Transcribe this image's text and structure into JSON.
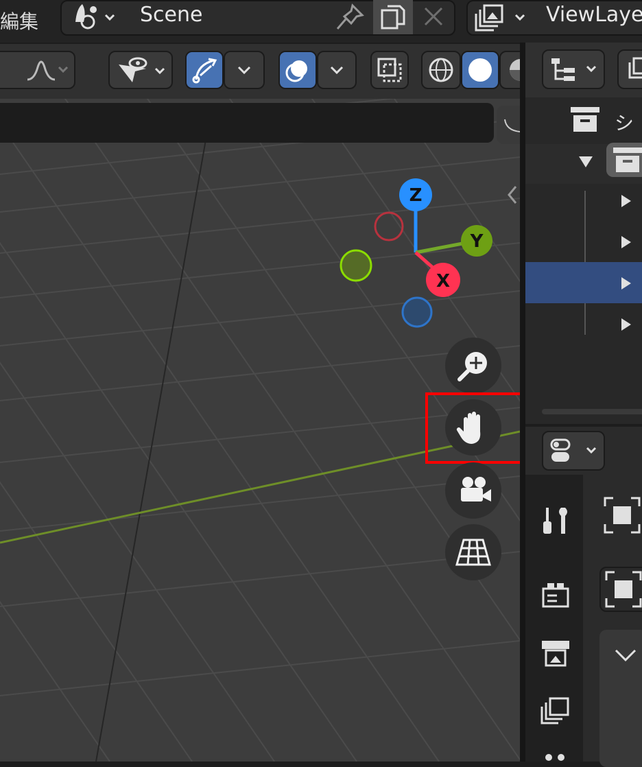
{
  "topbar": {
    "menu_fragment": "編集",
    "scene_name": "Scene",
    "view_layer_name": "ViewLayer"
  },
  "outliner": {
    "collection_label_fragment": "シ",
    "rows": [
      {
        "label": "",
        "selected": false
      },
      {
        "label": "",
        "selected": false
      },
      {
        "label": "",
        "selected": true
      },
      {
        "label": "",
        "selected": false
      }
    ]
  },
  "gizmo": {
    "axis_z": "Z",
    "axis_y": "Y",
    "axis_x": "X"
  },
  "navigation": {
    "zoom": "zoom-icon",
    "pan": "hand-icon",
    "camera": "camera-icon",
    "ortho": "grid-icon"
  },
  "highlight": {
    "target": "pan-view-button",
    "color": "#ff0000"
  },
  "colors": {
    "accent": "#4772b3",
    "axis_x": "#ff3352",
    "axis_y": "#8bdc00",
    "axis_z": "#2890ff",
    "selection_row": "#334d80"
  }
}
